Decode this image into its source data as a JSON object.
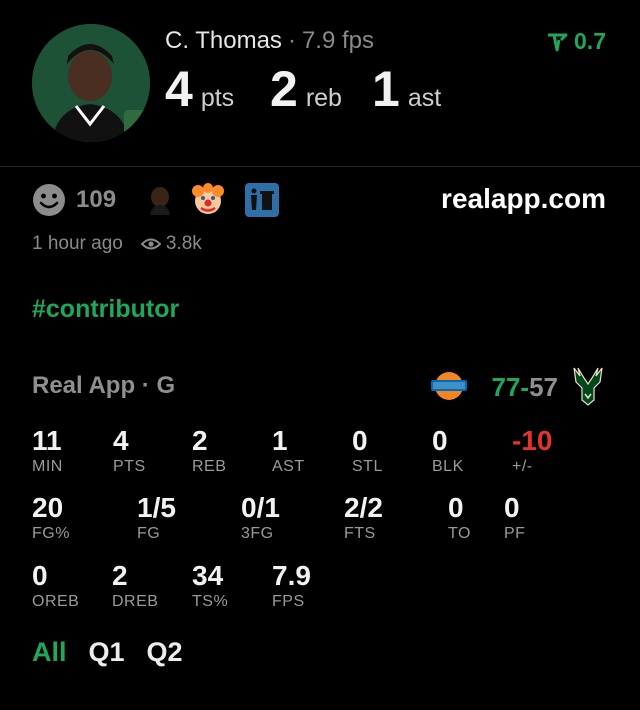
{
  "header": {
    "player_name": "C. Thomas",
    "separator": "·",
    "fps": "7.9 fps",
    "boost_value": "0.7",
    "stats": [
      {
        "value": "4",
        "unit": "pts"
      },
      {
        "value": "2",
        "unit": "reb"
      },
      {
        "value": "1",
        "unit": "ast"
      }
    ]
  },
  "reactions": {
    "count": "109",
    "icons": [
      "smile-icon",
      "player-avatar-icon",
      "clown-icon",
      "trash-icon"
    ]
  },
  "site": "realapp.com",
  "meta": {
    "time": "1 hour ago",
    "views": "3.8k"
  },
  "hashtag": "#contributor",
  "game": {
    "title": "Real App · G",
    "score_left": "77",
    "score_dash": "-",
    "score_right": "57"
  },
  "stats": {
    "row1": [
      {
        "value": "11",
        "label": "MIN"
      },
      {
        "value": "4",
        "label": "PTS"
      },
      {
        "value": "2",
        "label": "REB"
      },
      {
        "value": "1",
        "label": "AST"
      },
      {
        "value": "0",
        "label": "STL"
      },
      {
        "value": "0",
        "label": "BLK"
      },
      {
        "value": "-10",
        "label": "+/-"
      }
    ],
    "row2": [
      {
        "value": "20",
        "label": "FG%"
      },
      {
        "value": "1/5",
        "label": "FG"
      },
      {
        "value": "0/1",
        "label": "3FG"
      },
      {
        "value": "2/2",
        "label": "FTS"
      },
      {
        "value": "0",
        "label": "TO"
      },
      {
        "value": "0",
        "label": "PF"
      }
    ],
    "row3": [
      {
        "value": "0",
        "label": "OREB"
      },
      {
        "value": "2",
        "label": "DREB"
      },
      {
        "value": "34",
        "label": "TS%"
      },
      {
        "value": "7.9",
        "label": "FPS"
      }
    ]
  },
  "tabs": [
    {
      "label": "All",
      "active": true
    },
    {
      "label": "Q1",
      "active": false
    },
    {
      "label": "Q2",
      "active": false
    }
  ],
  "colors": {
    "accent_green": "#1ea85a",
    "negative_red": "#e3332e",
    "bucks_green": "#00471b",
    "knicks_orange": "#f58426",
    "knicks_blue": "#006bb6"
  }
}
